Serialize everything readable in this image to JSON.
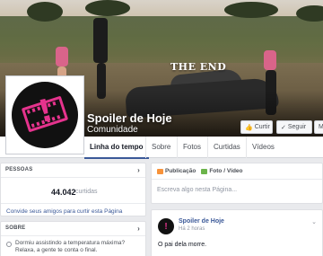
{
  "cover": {
    "overlay_text": "THE END"
  },
  "page": {
    "name": "Spoiler de Hoje",
    "category": "Comunidade"
  },
  "actions": {
    "like": {
      "icon": "thumbs-up-icon",
      "label": "Curtir"
    },
    "follow": {
      "icon": "check-icon",
      "label": "Seguir"
    },
    "message": {
      "label": "M"
    }
  },
  "tabs": [
    {
      "label": "Linha do tempo",
      "active": true
    },
    {
      "label": "Sobre"
    },
    {
      "label": "Fotos"
    },
    {
      "label": "Curtidas"
    },
    {
      "label": "Vídeos"
    }
  ],
  "people": {
    "header": "PESSOAS",
    "count": "44.042",
    "count_label": "curtidas",
    "invite": "Convide seus amigos para curtir esta Página"
  },
  "about": {
    "header": "SOBRE",
    "text": "Dormiu assistindo a temperatura máxima? Relaxa, a gente te conta o final."
  },
  "composer": {
    "tabs": [
      {
        "label": "Publicação",
        "icon": "pencil-icon",
        "color": "#f7923a"
      },
      {
        "label": "Foto / Vídeo",
        "icon": "camera-icon",
        "color": "#6bb34a"
      }
    ],
    "placeholder": "Escreva algo nesta Página..."
  },
  "post": {
    "author": "Spoiler de Hoje",
    "time": "Há 2 horas",
    "text": "O pai dela morre."
  },
  "colors": {
    "brand": "#3b5998",
    "logo_pink": "#e5338d"
  }
}
